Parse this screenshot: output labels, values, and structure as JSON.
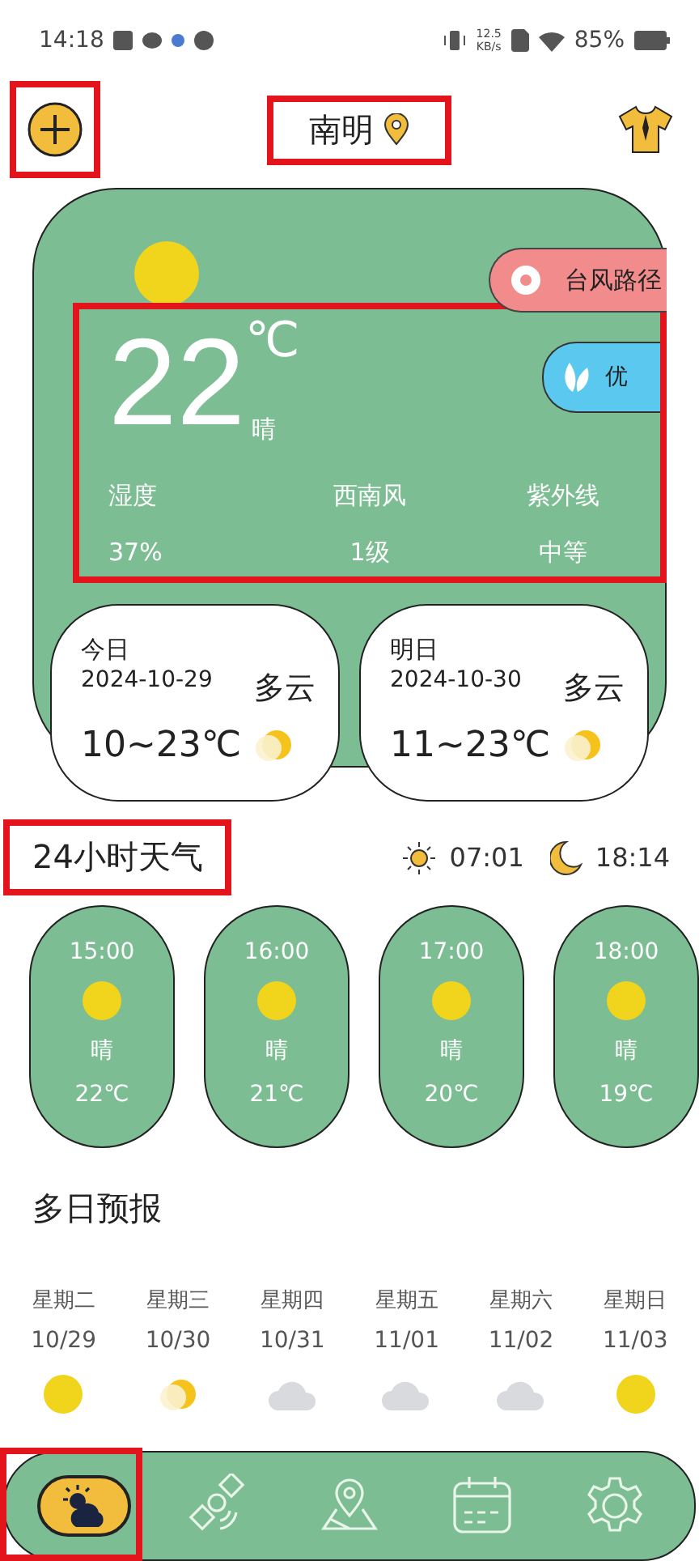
{
  "status_bar": {
    "time": "14:18",
    "net_speed": "12.5",
    "net_unit": "KB/s",
    "battery": "85%"
  },
  "header": {
    "add_highlighted": true,
    "location": "南明",
    "location_highlighted": true
  },
  "current": {
    "temperature": "22",
    "unit": "℃",
    "condition": "晴",
    "typhoon_button": "台风路径",
    "aqi": "优",
    "highlighted": true,
    "details": [
      {
        "label": "湿度",
        "value": "37%"
      },
      {
        "label": "西南风",
        "value": "1级"
      },
      {
        "label": "紫外线",
        "value": "中等"
      }
    ]
  },
  "day_cards": [
    {
      "day": "今日",
      "date": "2024-10-29",
      "condition": "多云",
      "range": "10~23℃"
    },
    {
      "day": "明日",
      "date": "2024-10-30",
      "condition": "多云",
      "range": "11~23℃"
    }
  ],
  "hourly": {
    "title": "24小时天气",
    "title_highlighted": true,
    "sunrise": "07:01",
    "sunset": "18:14",
    "hours": [
      {
        "time": "15:00",
        "kind": "sun",
        "condition": "晴",
        "temp": "22℃"
      },
      {
        "time": "16:00",
        "kind": "sun",
        "condition": "晴",
        "temp": "21℃"
      },
      {
        "time": "17:00",
        "kind": "sun",
        "condition": "晴",
        "temp": "20℃"
      },
      {
        "time": "18:00",
        "kind": "sun",
        "condition": "晴",
        "temp": "19℃"
      }
    ]
  },
  "daily": {
    "title": "多日预报",
    "days": [
      {
        "weekday": "星期二",
        "date": "10/29",
        "kind": "sun"
      },
      {
        "weekday": "星期三",
        "date": "10/30",
        "kind": "partly"
      },
      {
        "weekday": "星期四",
        "date": "10/31",
        "kind": "cloud"
      },
      {
        "weekday": "星期五",
        "date": "11/01",
        "kind": "cloud"
      },
      {
        "weekday": "星期六",
        "date": "11/02",
        "kind": "cloud"
      },
      {
        "weekday": "星期日",
        "date": "11/03",
        "kind": "sun"
      }
    ]
  },
  "nav": [
    {
      "kind": "weather",
      "selected": true,
      "highlighted": true
    },
    {
      "kind": "satellite",
      "selected": false,
      "highlighted": false
    },
    {
      "kind": "map",
      "selected": false,
      "highlighted": false
    },
    {
      "kind": "calendar",
      "selected": false,
      "highlighted": false
    },
    {
      "kind": "settings",
      "selected": false,
      "highlighted": false
    }
  ]
}
